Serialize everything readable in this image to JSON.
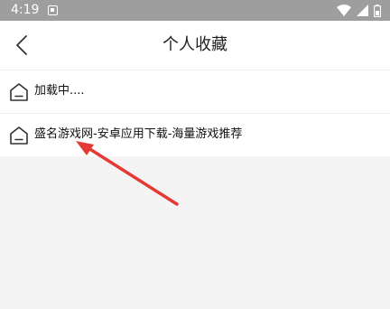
{
  "status_bar": {
    "time": "4:19",
    "icons": [
      "notification-icon",
      "wifi-icon",
      "signal-icon",
      "battery-icon"
    ]
  },
  "header": {
    "title": "个人收藏",
    "back_icon": "chevron-left-icon"
  },
  "favorites": [
    {
      "label": "加载中....",
      "icon": "home-icon"
    },
    {
      "label": "盛名游戏网-安卓应用下载-海量游戏推荐",
      "icon": "home-icon"
    }
  ],
  "annotation": {
    "color": "#e53935"
  }
}
